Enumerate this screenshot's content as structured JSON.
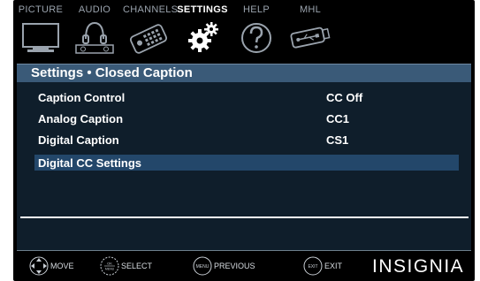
{
  "tabs": [
    {
      "label": "PICTURE",
      "icon": "tv-icon",
      "active": false
    },
    {
      "label": "AUDIO",
      "icon": "headphones-speaker-icon",
      "active": false
    },
    {
      "label": "CHANNELS",
      "icon": "remote-control-icon",
      "active": false
    },
    {
      "label": "SETTINGS",
      "icon": "gears-icon",
      "active": true
    },
    {
      "label": "HELP",
      "icon": "question-mark-icon",
      "active": false
    },
    {
      "label": "MHL",
      "icon": "usb-device-icon",
      "active": false
    }
  ],
  "title": "Settings • Closed Caption",
  "menu": [
    {
      "label": "Caption Control",
      "value": "CC Off"
    },
    {
      "label": "Analog Caption",
      "value": "CC1"
    },
    {
      "label": "Digital Caption",
      "value": "CS1"
    },
    {
      "label": "Digital CC Settings",
      "value": ""
    }
  ],
  "help": {
    "move": "MOVE",
    "select": "SELECT",
    "select_icon_text": "OK MENU",
    "previous": "PREVIOUS",
    "previous_icon_text": "MENU",
    "exit": "EXIT",
    "exit_icon_text": "EXIT"
  },
  "brand": "INSIGNIA",
  "colors": {
    "title_bar": "#3a5a78",
    "highlight": "#23476a",
    "panel": "#0f1e2b"
  }
}
